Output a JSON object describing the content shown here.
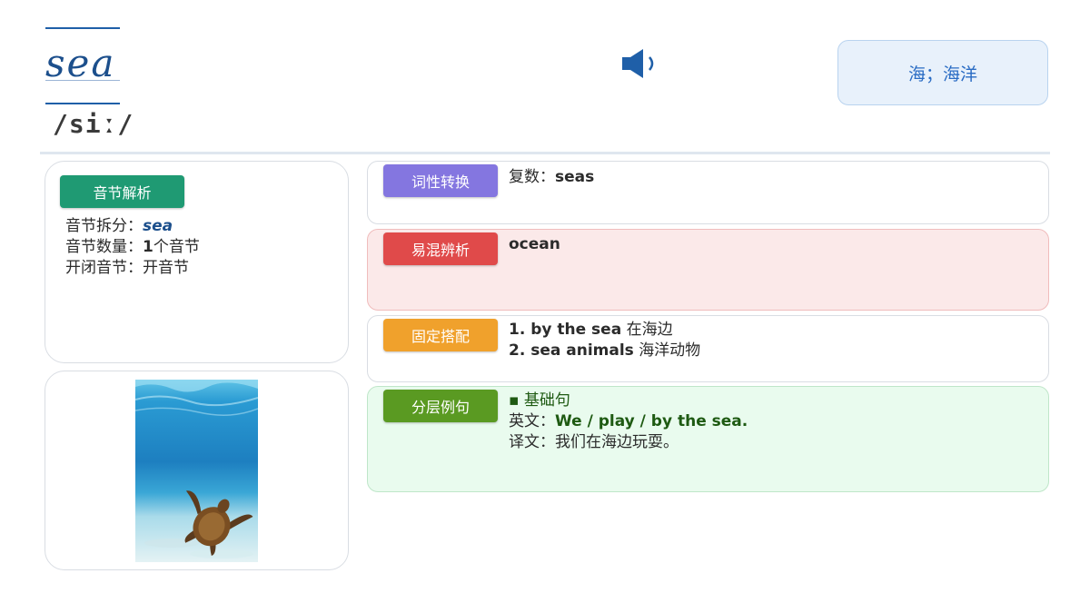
{
  "header": {
    "word": "sea",
    "phonetic": "/siː/",
    "meaning": "海；海洋",
    "speaker_icon": "speaker-icon"
  },
  "syllable": {
    "tag": "音节解析",
    "split_label": "音节拆分：",
    "split_value": "sea",
    "count_label": "音节数量：",
    "count_num": "1",
    "count_unit": "个音节",
    "open_label": "开闭音节：",
    "open_value": "开音节"
  },
  "pos": {
    "tag": "词性转换",
    "label": "复数：",
    "value": "seas"
  },
  "confusable": {
    "tag": "易混辨析",
    "value": "ocean"
  },
  "collocation": {
    "tag": "固定搭配",
    "items": [
      {
        "en": "1. by the sea",
        "cn": "在海边"
      },
      {
        "en": "2. sea animals",
        "cn": "海洋动物"
      }
    ]
  },
  "examples": {
    "tag": "分层例句",
    "level": "▪ 基础句",
    "en_label": "英文：",
    "en_value": "We / play / by the sea.",
    "cn_label": "译文：",
    "cn_value": "我们在海边玩耍。"
  },
  "colors": {
    "syllable_tag": "#1f9a73",
    "pos_tag": "#8476e0",
    "confusable_tag": "#e04a4a",
    "collocation_tag": "#f0a12c",
    "examples_tag": "#5a9a22",
    "word": "#1c4f8c"
  },
  "image": {
    "icon": "sea-turtle-photo"
  }
}
